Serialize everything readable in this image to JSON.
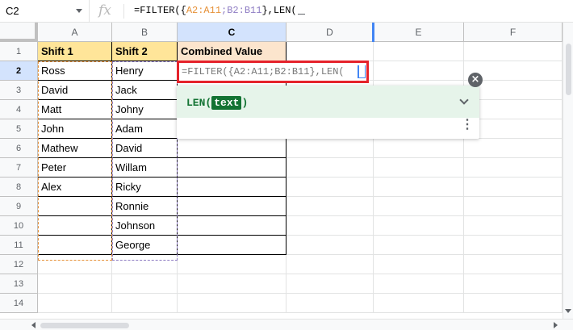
{
  "formula_bar": {
    "name_box": "C2",
    "fx_label": "fx",
    "formula_prefix": "=FILTER({",
    "range1": "A2:A11",
    "sep": ";",
    "range2": "B2:B11",
    "formula_suffix": "},LEN("
  },
  "columns": [
    "A",
    "B",
    "C",
    "D",
    "E",
    "F"
  ],
  "rows": [
    "1",
    "2",
    "3",
    "4",
    "5",
    "6",
    "7",
    "8",
    "9",
    "10",
    "11",
    "12",
    "13",
    "14"
  ],
  "headers": {
    "a": "Shift 1",
    "b": "Shift 2",
    "c": "Combined  Value"
  },
  "shift1": [
    "Ross",
    "David",
    "Matt",
    "John",
    "Mathew",
    "Peter",
    "Alex",
    "",
    "",
    ""
  ],
  "shift2": [
    "Henry",
    "Jack",
    "Johny",
    "Adam",
    "David",
    "Willam",
    "Ricky",
    "Ronnie",
    "Johnson",
    "George"
  ],
  "active_cell": {
    "formula": "=FILTER({A2:A11;B2:B11},LEN("
  },
  "tooltip": {
    "function": "LEN(",
    "argument": "text",
    "close_paren": ")",
    "close_label": "×",
    "more_label": "⋮"
  }
}
